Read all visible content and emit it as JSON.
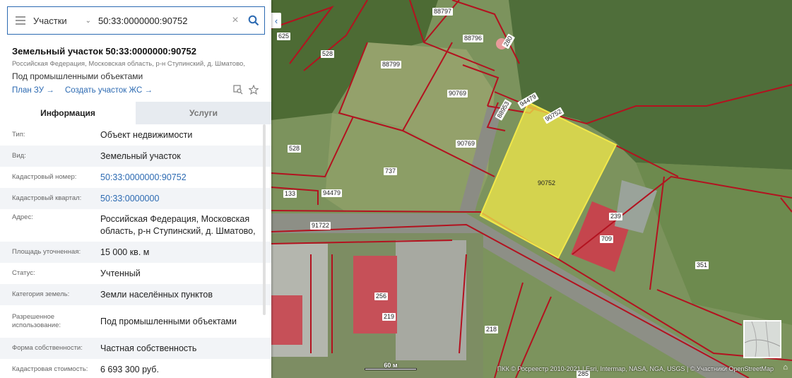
{
  "search": {
    "type_label": "Участки",
    "query": "50:33:0000000:90752"
  },
  "object": {
    "title": "Земельный участок 50:33:0000000:90752",
    "address_short": "Российская Федерация, Московская область, р-н Ступинский, д. Шматово,",
    "use": "Под промышленными объектами",
    "link_plan": "План ЗУ →",
    "link_create": "Создать участок ЖС →"
  },
  "tabs": [
    {
      "label": "Информация",
      "active": true
    },
    {
      "label": "Услуги",
      "active": false
    }
  ],
  "info_rows": [
    {
      "key": "Тип:",
      "value": "Объект недвижимости"
    },
    {
      "key": "Вид:",
      "value": "Земельный участок"
    },
    {
      "key": "Кадастровый номер:",
      "value": "50:33:0000000:90752"
    },
    {
      "key": "Кадастровый квартал:",
      "value": "50:33:0000000"
    },
    {
      "key": "Адрес:",
      "value": "Российская Федерация, Московская область, р-н Ступинский, д. Шматово,"
    },
    {
      "key": "Площадь уточненная:",
      "value": "15 000 кв. м"
    },
    {
      "key": "Статус:",
      "value": "Учтенный"
    },
    {
      "key": "Категория земель:",
      "value": "Земли населённых пунктов"
    },
    {
      "key": "Разрешенное использование:",
      "value": "Под промышленными объектами"
    },
    {
      "key": "Форма собственности:",
      "value": "Частная собственность"
    },
    {
      "key": "Кадастровая стоимость:",
      "value": "6 693 300 руб."
    }
  ],
  "map": {
    "parcel_labels": [
      "625",
      "528",
      "88797",
      "88796",
      "280",
      "88799",
      "90769",
      "94479",
      "88953",
      "90752",
      "528",
      "90769",
      "737",
      "133",
      "94479",
      "91722",
      "90752",
      "239",
      "709",
      "351",
      "256",
      "219",
      "218",
      "285"
    ],
    "scale_label": "60 м",
    "attribution": "ПКК © Росреестр 2010-2021 | Esri, Intermap, NASA, NGA, USGS | © Участники OpenStreetMap"
  },
  "colors": {
    "accent": "#2c6ab2",
    "boundary": "#b3121f",
    "selected_fill": "#f2e84a"
  }
}
